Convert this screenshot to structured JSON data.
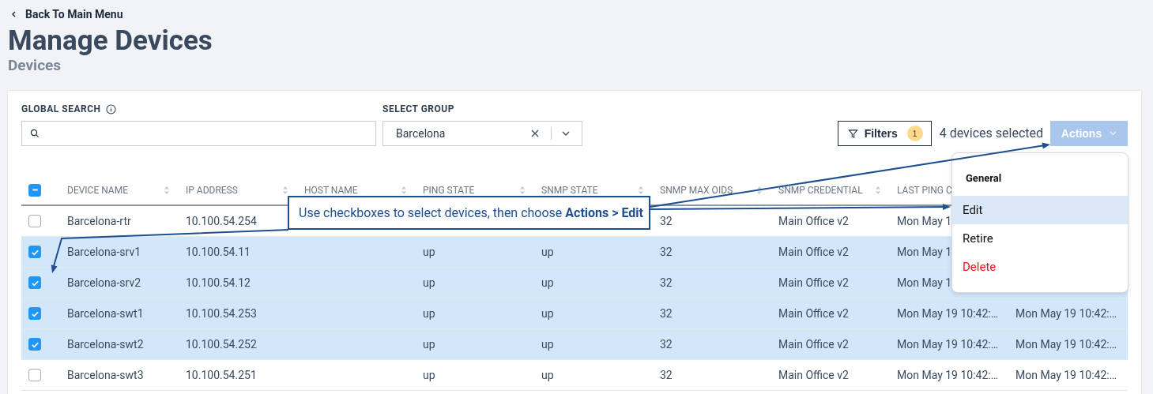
{
  "back_link": {
    "label": "Back To Main Menu"
  },
  "title": "Manage Devices",
  "subtitle": "Devices",
  "global_search": {
    "label": "GLOBAL SEARCH"
  },
  "select_group": {
    "label": "SELECT GROUP",
    "value": "Barcelona"
  },
  "filters": {
    "label": "Filters",
    "count": "1"
  },
  "selection_summary": "4 devices selected",
  "actions_button": {
    "label": "Actions",
    "disabled": true
  },
  "actions_menu": {
    "section": "General",
    "items": [
      {
        "label": "Edit",
        "kind": "normal",
        "selected": true
      },
      {
        "label": "Retire",
        "kind": "normal",
        "selected": false
      },
      {
        "label": "Delete",
        "kind": "danger",
        "selected": false
      }
    ]
  },
  "table": {
    "select_all": {
      "indeterminate": true
    },
    "columns": [
      "DEVICE NAME",
      "IP ADDRESS",
      "HOST NAME",
      "PING STATE",
      "SNMP STATE",
      "SNMP MAX OIDS",
      "SNMP CREDENTIAL",
      "LAST PING C"
    ],
    "rows": [
      {
        "checked": false,
        "cells": [
          "Barcelona-rtr",
          "10.100.54.254",
          null,
          null,
          null,
          "32",
          "Main Office v2",
          "Mon May 1",
          null
        ]
      },
      {
        "checked": true,
        "cells": [
          "Barcelona-srv1",
          "10.100.54.11",
          null,
          "up",
          "up",
          "32",
          "Main Office v2",
          "Mon May 1",
          null
        ]
      },
      {
        "checked": true,
        "cells": [
          "Barcelona-srv2",
          "10.100.54.12",
          null,
          "up",
          "up",
          "32",
          "Main Office v2",
          "Mon May 1",
          null
        ]
      },
      {
        "checked": true,
        "cells": [
          "Barcelona-swt1",
          "10.100.54.253",
          null,
          "up",
          "up",
          "32",
          "Main Office v2",
          "Mon May 19 10:42:…",
          "Mon May 19 10:42:…"
        ]
      },
      {
        "checked": true,
        "cells": [
          "Barcelona-swt2",
          "10.100.54.252",
          null,
          "up",
          "up",
          "32",
          "Main Office v2",
          "Mon May 19 10:42:…",
          "Mon May 19 10:42:…"
        ]
      },
      {
        "checked": false,
        "cells": [
          "Barcelona-swt3",
          "10.100.54.251",
          null,
          "up",
          "up",
          "32",
          "Main Office v2",
          "Mon May 19 10:42:…",
          "Mon May 19 10:42:…"
        ]
      }
    ]
  },
  "callout": {
    "text": "Use checkboxes to select devices, then choose **Actions > Edit**"
  }
}
